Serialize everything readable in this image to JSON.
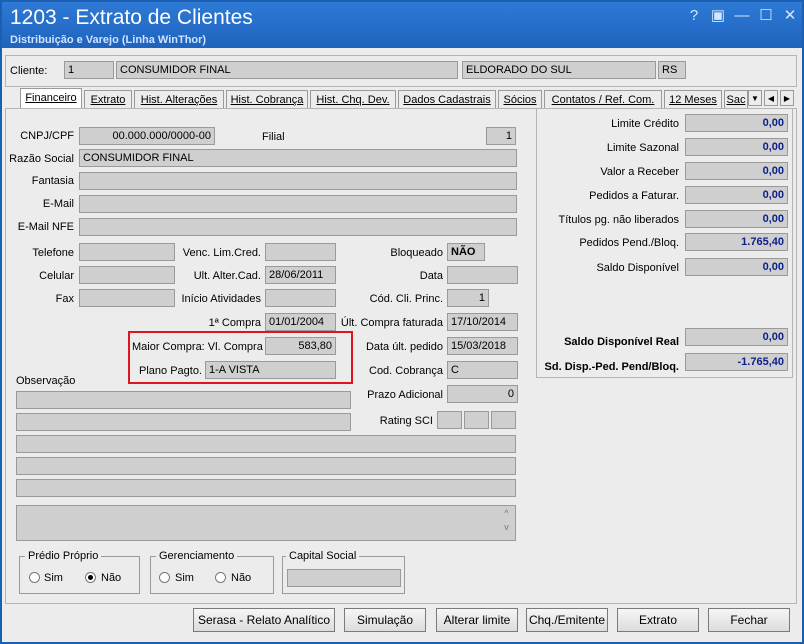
{
  "window": {
    "title": "1203 - Extrato de Clientes",
    "subtitle": "Distribuição e Varejo (Linha WinThor)",
    "controls": [
      "?",
      "▣",
      "—",
      "☐",
      "✕"
    ]
  },
  "cliente": {
    "label": "Cliente:",
    "code": "1",
    "name": "CONSUMIDOR FINAL",
    "city": "ELDORADO DO SUL",
    "uf": "RS"
  },
  "tabs": [
    "Financeiro",
    "Extrato",
    "Hist. Alterações",
    "Hist. Cobrança",
    "Hist. Chq. Dev.",
    "Dados Cadastrais",
    "Sócios",
    "Contatos / Ref. Com.",
    "12 Meses",
    "Sac"
  ],
  "form": {
    "cnpj_label": "CNPJ/CPF",
    "cnpj": "00.000.000/0000-00",
    "filial_label": "Filial",
    "filial": "1",
    "razao_label": "Razão Social",
    "razao": "CONSUMIDOR FINAL",
    "fantasia_label": "Fantasia",
    "fantasia": "",
    "email_label": "E-Mail",
    "email": "",
    "email_nfe_label": "E-Mail NFE",
    "email_nfe": "",
    "telefone_label": "Telefone",
    "telefone": "",
    "celular_label": "Celular",
    "celular": "",
    "fax_label": "Fax",
    "fax": "",
    "venc_label": "Venc. Lim.Cred.",
    "venc": "",
    "ult_alter_label": "Ult. Alter.Cad.",
    "ult_alter": "28/06/2011",
    "inicio_label": "Início Atividades",
    "inicio": "",
    "bloqueado_label": "Bloqueado",
    "bloqueado": "NÃO",
    "data_label": "Data",
    "data": "",
    "cod_cli_label": "Cód. Cli. Princ.",
    "cod_cli": "1",
    "primeira_compra_label": "1ª Compra",
    "primeira_compra": "01/01/2004",
    "ult_compra_label": "Últ. Compra faturada",
    "ult_compra": "17/10/2014",
    "maior_compra_label": "Maior Compra: Vl. Compra",
    "maior_compra": "583,80",
    "data_ult_pedido_label": "Data últ. pedido",
    "data_ult_pedido": "15/03/2018",
    "plano_label": "Plano Pagto.",
    "plano": "1-A VISTA",
    "cod_cobranca_label": "Cod. Cobrança",
    "cod_cobranca": "C",
    "observacao_label": "Observação",
    "prazo_label": "Prazo Adicional",
    "prazo": "0",
    "rating_label": "Rating SCI"
  },
  "limits": {
    "limite_credito_label": "Limite Crédito",
    "limite_credito": "0,00",
    "limite_sazonal_label": "Limite Sazonal",
    "limite_sazonal": "0,00",
    "valor_receber_label": "Valor a Receber",
    "valor_receber": "0,00",
    "pedidos_faturar_label": "Pedidos a Faturar.",
    "pedidos_faturar": "0,00",
    "titulos_label": "Títulos pg. não liberados",
    "titulos": "0,00",
    "pedidos_pend_label": "Pedidos Pend./Bloq.",
    "pedidos_pend": "1.765,40",
    "saldo_label": "Saldo Disponível",
    "saldo": "0,00",
    "saldo_real_label": "Saldo Disponível Real",
    "saldo_real": "0,00",
    "sd_disp_label": "Sd. Disp.-Ped. Pend/Bloq.",
    "sd_disp": "-1.765,40"
  },
  "groups": {
    "predio_label": "Prédio Próprio",
    "gerenciamento_label": "Gerenciamento",
    "capital_label": "Capital Social",
    "sim_label": "Sim",
    "nao_label": "Não"
  },
  "buttons": {
    "serasa": "Serasa - Relato Analítico",
    "simulacao": "Simulação",
    "alterar_limite": "Alterar limite",
    "chq_emitente": "Chq./Emitente",
    "extrato": "Extrato",
    "fechar": "Fechar"
  },
  "colors": {
    "titlebar": "#1e63bd",
    "highlight_box": "#e0141e",
    "value_blue": "#0b1f8a"
  }
}
